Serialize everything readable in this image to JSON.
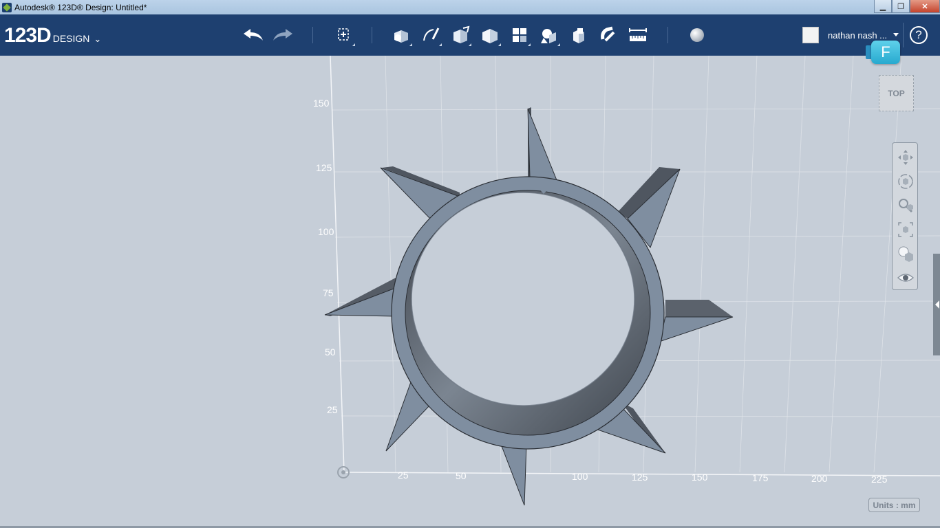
{
  "window": {
    "title": "Autodesk® 123D® Design: Untitled*",
    "minimize": "▁",
    "maximize": "❐",
    "close": "✕"
  },
  "app": {
    "logo_main": "123D",
    "logo_sub": "DESIGN",
    "logo_chevron": "⌄"
  },
  "toolbar": {
    "icons": [
      "undo-icon",
      "redo-icon",
      "transform-icon",
      "primitives-icon",
      "sketch-icon",
      "construct-icon",
      "modify-icon",
      "pattern-icon",
      "grouping-icon",
      "combine-icon",
      "snap-icon",
      "measure-icon",
      "material-icon"
    ]
  },
  "user": {
    "name": "nathan nash ...",
    "help": "?"
  },
  "badge": {
    "label": "F"
  },
  "view_cube": {
    "label": "TOP"
  },
  "nav": {
    "items": [
      "pan-icon",
      "orbit-icon",
      "zoom-icon",
      "fit-icon",
      "view-style-icon",
      "visibility-icon"
    ]
  },
  "axes": {
    "y_labels": [
      "150",
      "125",
      "100",
      "75",
      "50",
      "25"
    ],
    "x_labels": [
      "25",
      "50",
      "100",
      "125",
      "150",
      "175",
      "200",
      "225"
    ]
  },
  "units": "Units : mm",
  "colors": {
    "toolbar": "#1e4070",
    "viewport": "#c6ced8",
    "model_face": "#7f8ea0",
    "model_side": "#585f69"
  }
}
